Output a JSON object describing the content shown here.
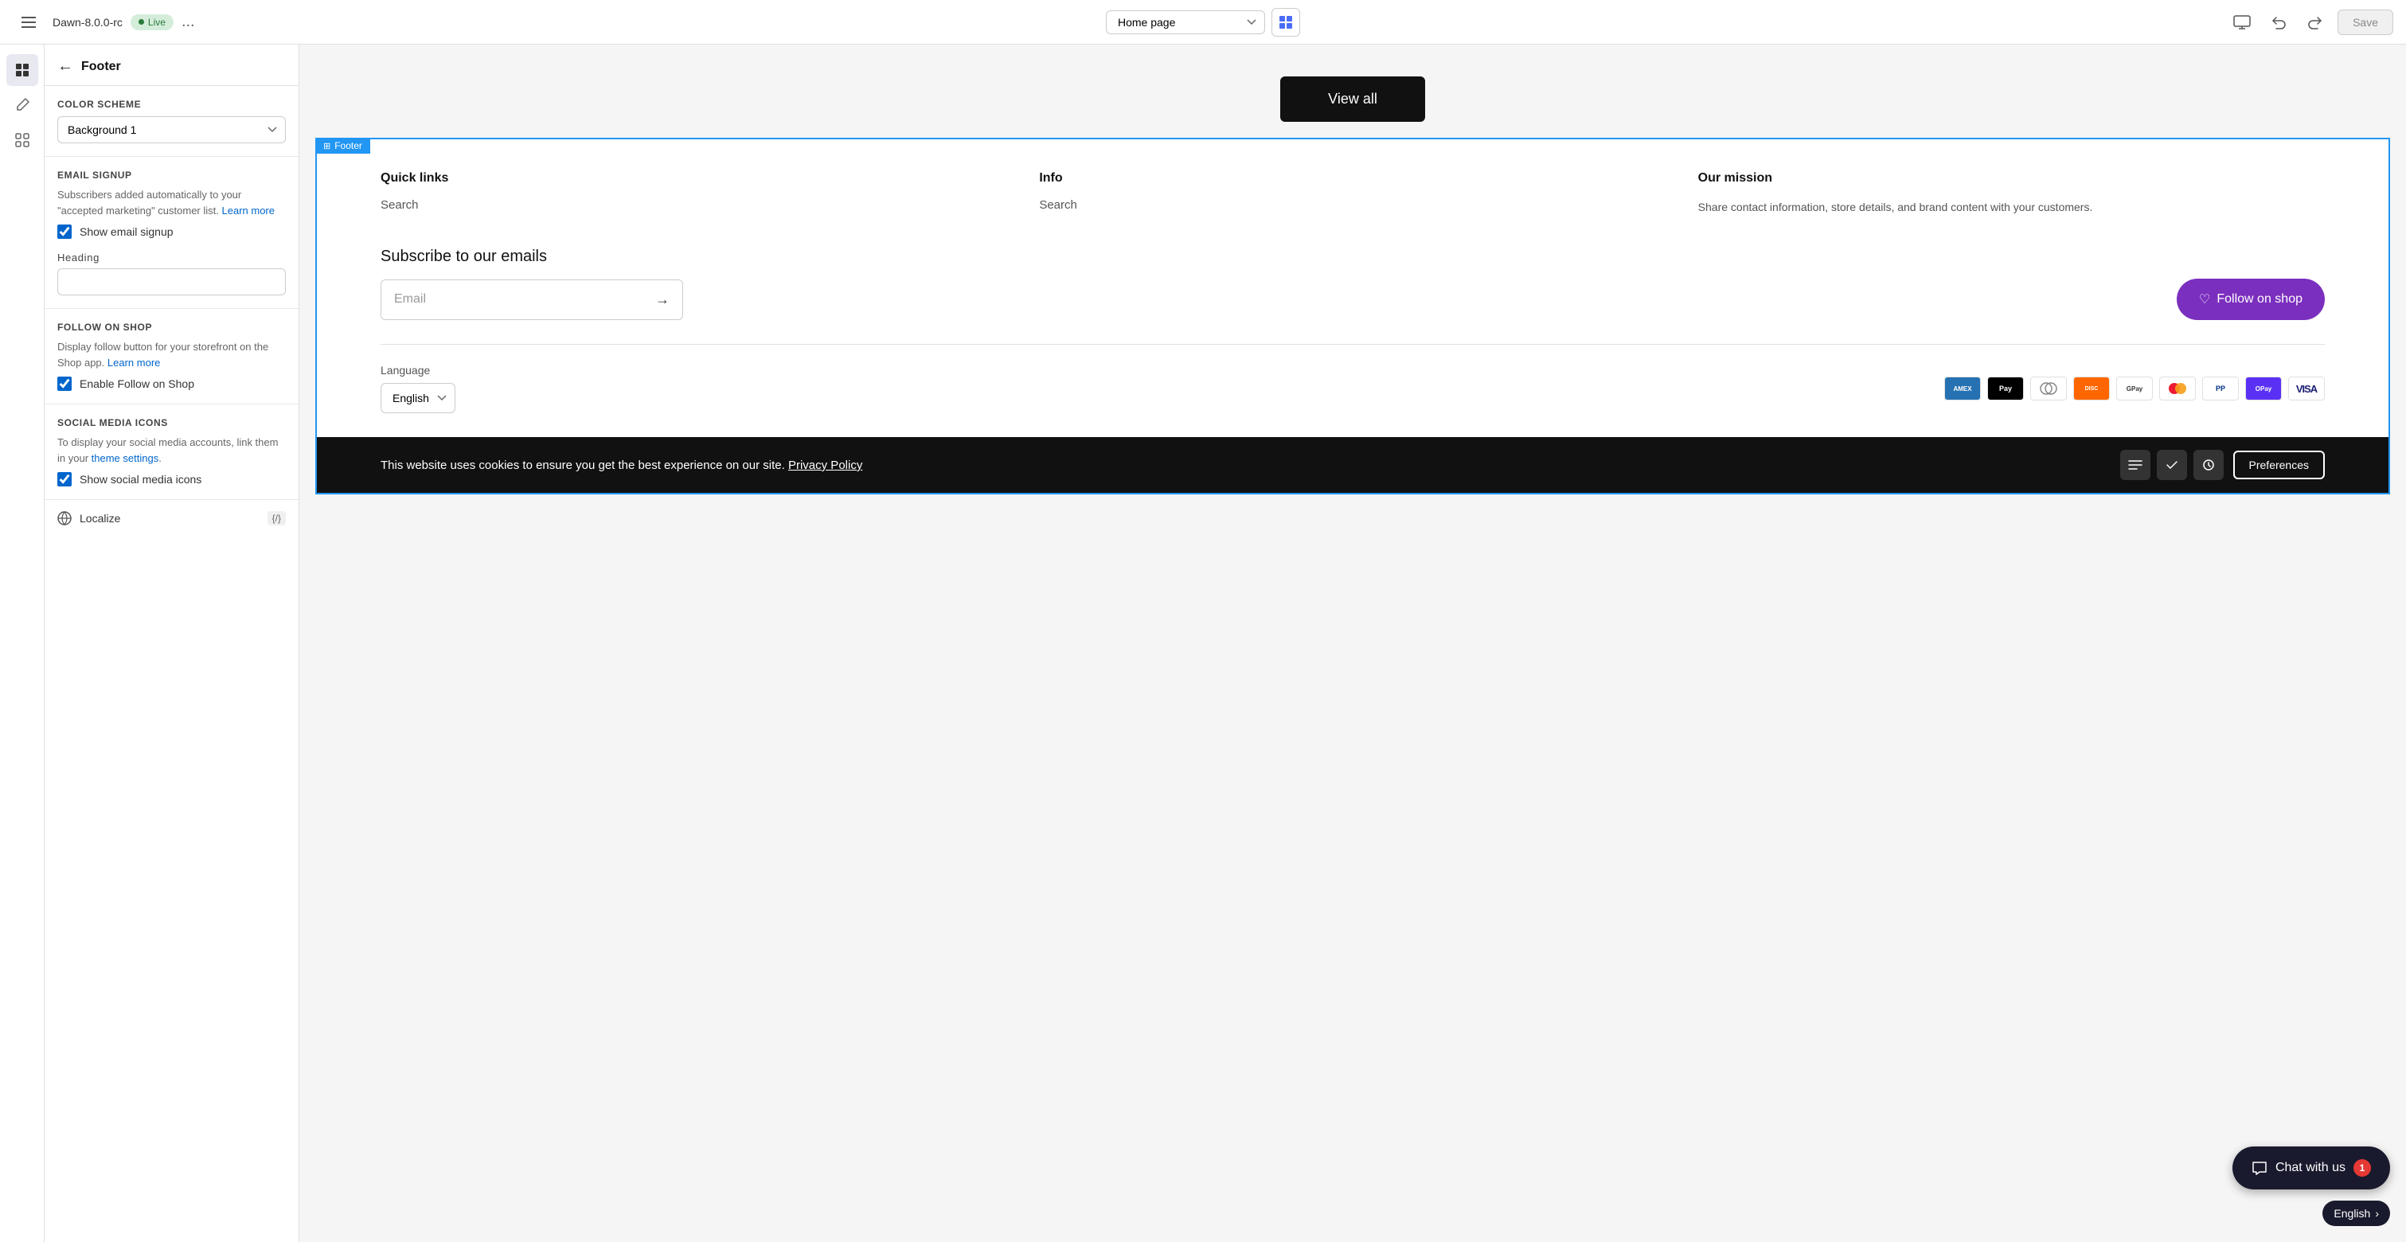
{
  "topbar": {
    "app_name": "Dawn-8.0.0-rc",
    "live_label": "Live",
    "more_options": "...",
    "page_selector_value": "Home page",
    "save_label": "Save"
  },
  "settings_panel": {
    "title": "Footer",
    "color_scheme_label": "Color scheme",
    "color_scheme_value": "Background 1",
    "email_signup": {
      "section_label": "EMAIL SIGNUP",
      "description": "Subscribers added automatically to your \"accepted marketing\" customer list.",
      "learn_more": "Learn more",
      "checkbox_label": "Show email signup",
      "heading_label": "Heading",
      "heading_value": "Subscribe to our emails"
    },
    "follow_on_shop": {
      "section_label": "FOLLOW ON SHOP",
      "description": "Display follow button for your storefront on the Shop app.",
      "learn_more": "Learn more",
      "checkbox_label": "Enable Follow on Shop"
    },
    "social_media": {
      "section_label": "SOCIAL MEDIA ICONS",
      "description": "To display your social media accounts, link them in your",
      "theme_settings": "theme settings",
      "checkbox_label": "Show social media icons"
    },
    "localize": {
      "label": "Localize",
      "code": "{/}"
    }
  },
  "footer_preview": {
    "tag": "Footer",
    "view_all_label": "View all",
    "columns": [
      {
        "title": "Quick links",
        "links": [
          "Search"
        ]
      },
      {
        "title": "Info",
        "links": [
          "Search"
        ]
      },
      {
        "title": "Our mission",
        "description": "Share contact information, store details, and brand content with your customers."
      }
    ],
    "subscribe": {
      "title": "Subscribe to our emails",
      "email_placeholder": "Email",
      "follow_btn": "Follow on shop"
    },
    "bottom": {
      "language_label": "Language",
      "language_value": "English",
      "payment_methods": [
        "AMEX",
        "Apple Pay",
        "Diners",
        "DISCOVER",
        "Google Pay",
        "MasterCard",
        "PayPal",
        "OPay",
        "VISA"
      ]
    },
    "cookie": {
      "text": "This website uses cookies to ensure you get the best experience on our site. Privacy Policy",
      "privacy_link": "Privacy Policy",
      "preferences_btn": "Preferences"
    }
  },
  "chat_widget": {
    "label": "Chat with us",
    "badge": "1",
    "english_label": "English"
  }
}
